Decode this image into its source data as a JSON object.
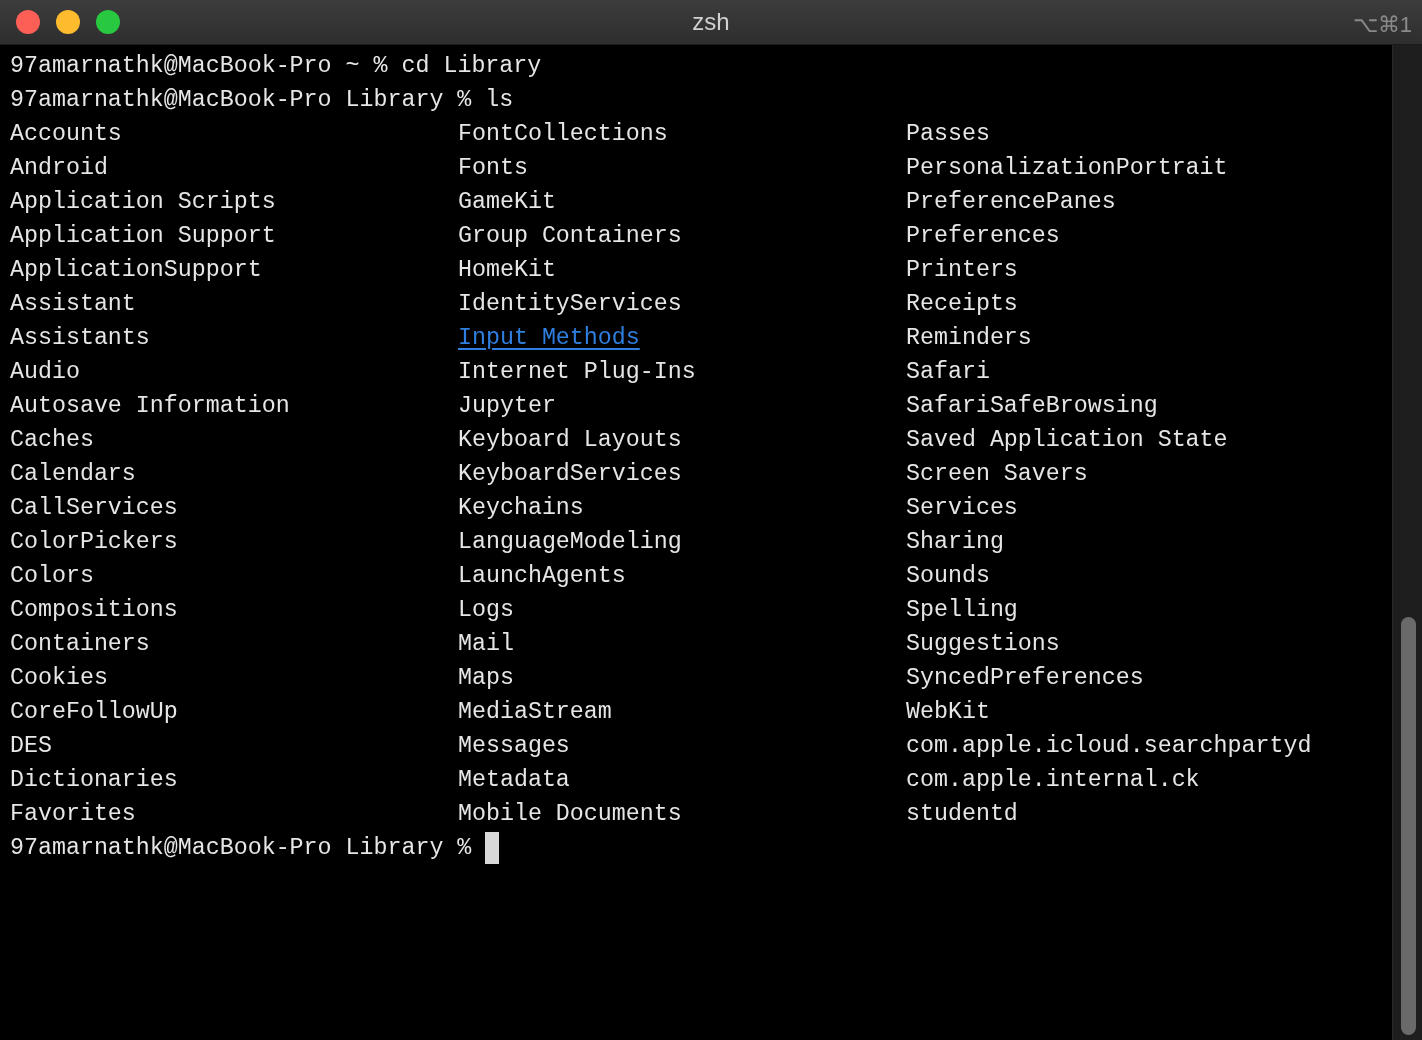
{
  "window": {
    "title": "zsh",
    "shortcut": "⌥⌘1"
  },
  "terminal": {
    "commands": [
      {
        "prompt": "97amarnathk@MacBook-Pro ~ %",
        "command": "cd Library"
      },
      {
        "prompt": "97amarnathk@MacBook-Pro Library %",
        "command": "ls"
      }
    ],
    "listing": [
      [
        {
          "text": "Accounts",
          "underlined": false
        },
        {
          "text": "Android",
          "underlined": false
        },
        {
          "text": "Application Scripts",
          "underlined": false
        },
        {
          "text": "Application Support",
          "underlined": false
        },
        {
          "text": "ApplicationSupport",
          "underlined": false
        },
        {
          "text": "Assistant",
          "underlined": false
        },
        {
          "text": "Assistants",
          "underlined": false
        },
        {
          "text": "Audio",
          "underlined": false
        },
        {
          "text": "Autosave Information",
          "underlined": false
        },
        {
          "text": "Caches",
          "underlined": false
        },
        {
          "text": "Calendars",
          "underlined": false
        },
        {
          "text": "CallServices",
          "underlined": false
        },
        {
          "text": "ColorPickers",
          "underlined": false
        },
        {
          "text": "Colors",
          "underlined": false
        },
        {
          "text": "Compositions",
          "underlined": false
        },
        {
          "text": "Containers",
          "underlined": false
        },
        {
          "text": "Cookies",
          "underlined": false
        },
        {
          "text": "CoreFollowUp",
          "underlined": false
        },
        {
          "text": "DES",
          "underlined": false
        },
        {
          "text": "Dictionaries",
          "underlined": false
        },
        {
          "text": "Favorites",
          "underlined": false
        }
      ],
      [
        {
          "text": "FontCollections",
          "underlined": false
        },
        {
          "text": "Fonts",
          "underlined": false
        },
        {
          "text": "GameKit",
          "underlined": false
        },
        {
          "text": "Group Containers",
          "underlined": false
        },
        {
          "text": "HomeKit",
          "underlined": false
        },
        {
          "text": "IdentityServices",
          "underlined": false
        },
        {
          "text": "Input Methods",
          "underlined": true
        },
        {
          "text": "Internet Plug-Ins",
          "underlined": false
        },
        {
          "text": "Jupyter",
          "underlined": false
        },
        {
          "text": "Keyboard Layouts",
          "underlined": false
        },
        {
          "text": "KeyboardServices",
          "underlined": false
        },
        {
          "text": "Keychains",
          "underlined": false
        },
        {
          "text": "LanguageModeling",
          "underlined": false
        },
        {
          "text": "LaunchAgents",
          "underlined": false
        },
        {
          "text": "Logs",
          "underlined": false
        },
        {
          "text": "Mail",
          "underlined": false
        },
        {
          "text": "Maps",
          "underlined": false
        },
        {
          "text": "MediaStream",
          "underlined": false
        },
        {
          "text": "Messages",
          "underlined": false
        },
        {
          "text": "Metadata",
          "underlined": false
        },
        {
          "text": "Mobile Documents",
          "underlined": false
        }
      ],
      [
        {
          "text": "Passes",
          "underlined": false
        },
        {
          "text": "PersonalizationPortrait",
          "underlined": false
        },
        {
          "text": "PreferencePanes",
          "underlined": false
        },
        {
          "text": "Preferences",
          "underlined": false
        },
        {
          "text": "Printers",
          "underlined": false
        },
        {
          "text": "Receipts",
          "underlined": false
        },
        {
          "text": "Reminders",
          "underlined": false
        },
        {
          "text": "Safari",
          "underlined": false
        },
        {
          "text": "SafariSafeBrowsing",
          "underlined": false
        },
        {
          "text": "Saved Application State",
          "underlined": false
        },
        {
          "text": "Screen Savers",
          "underlined": false
        },
        {
          "text": "Services",
          "underlined": false
        },
        {
          "text": "Sharing",
          "underlined": false
        },
        {
          "text": "Sounds",
          "underlined": false
        },
        {
          "text": "Spelling",
          "underlined": false
        },
        {
          "text": "Suggestions",
          "underlined": false
        },
        {
          "text": "SyncedPreferences",
          "underlined": false
        },
        {
          "text": "WebKit",
          "underlined": false
        },
        {
          "text": "com.apple.icloud.searchpartyd",
          "underlined": false
        },
        {
          "text": "com.apple.internal.ck",
          "underlined": false
        },
        {
          "text": "studentd",
          "underlined": false
        }
      ]
    ],
    "current_prompt": "97amarnathk@MacBook-Pro Library %"
  }
}
